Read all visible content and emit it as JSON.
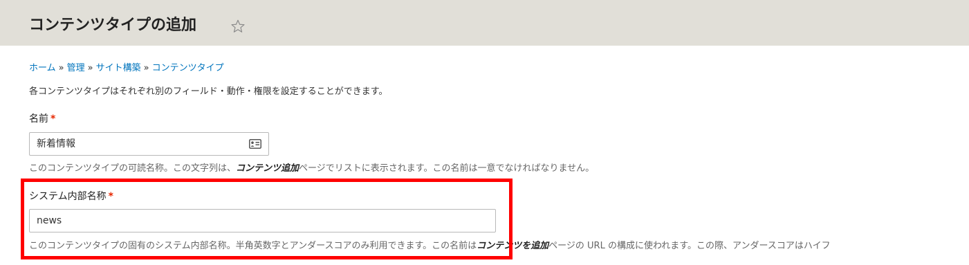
{
  "header": {
    "title": "コンテンツタイプの追加",
    "star_icon": "star-outline-icon"
  },
  "breadcrumb": {
    "items": [
      "ホーム",
      "管理",
      "サイト構築",
      "コンテンツタイプ"
    ],
    "separator": "»"
  },
  "description": "各コンテンツタイプはそれぞれ別のフィールド・動作・権限を設定することができます。",
  "name_field": {
    "label": "名前",
    "required_mark": "*",
    "value": "新着情報",
    "icon": "contact-card-icon",
    "help_before": "このコンテンツタイプの可読名称。この文字列は、",
    "help_emphasis": "コンテンツ追加",
    "help_after": "ページでリストに表示されます。この名前は一意でなければなりません。"
  },
  "system_name_field": {
    "label": "システム内部名称",
    "required_mark": "*",
    "value": "news",
    "help_before": "このコンテンツタイプの固有のシステム内部名称。半角英数字とアンダースコアのみ利用できます。この名前は",
    "help_emphasis": "コンテンツを追加",
    "help_after": "ページの URL の構成に使われます。この際、アンダースコアはハイフ"
  },
  "colors": {
    "header_bg": "#e1dfd8",
    "link": "#0074bd",
    "required": "#e62600",
    "highlight": "#ff0000"
  }
}
